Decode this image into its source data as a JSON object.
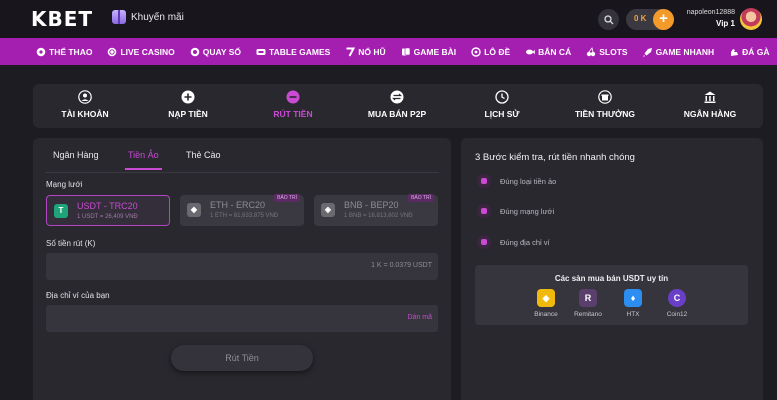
{
  "header": {
    "logo": "KBET",
    "promo_label": "Khuyến mãi",
    "balance": "0 K",
    "username": "napoleon12888",
    "vip": "Vip 1"
  },
  "nav": [
    {
      "label": "THỂ THAO",
      "icon": "soccer-ball-icon"
    },
    {
      "label": "LIVE CASINO",
      "icon": "casino-chip-icon"
    },
    {
      "label": "QUAY SỐ",
      "icon": "lottery-ball-icon"
    },
    {
      "label": "TABLE GAMES",
      "icon": "cards-icon"
    },
    {
      "label": "NỔ HŨ",
      "icon": "seven-icon"
    },
    {
      "label": "GAME BÀI",
      "icon": "playing-cards-icon"
    },
    {
      "label": "LÔ ĐỀ",
      "icon": "lotto-icon"
    },
    {
      "label": "BẮN CÁ",
      "icon": "fish-icon"
    },
    {
      "label": "SLOTS",
      "icon": "cherry-icon"
    },
    {
      "label": "GAME NHANH",
      "icon": "rocket-icon"
    },
    {
      "label": "ĐÁ GÀ",
      "icon": "rooster-icon"
    }
  ],
  "account_tabs": [
    {
      "label": "TÀI KHOẢN",
      "icon": "user-icon"
    },
    {
      "label": "NẠP TIỀN",
      "icon": "plus-circle-icon"
    },
    {
      "label": "RÚT TIỀN",
      "icon": "minus-circle-icon",
      "active": true
    },
    {
      "label": "MUA BÁN P2P",
      "icon": "swap-icon"
    },
    {
      "label": "LỊCH SỬ",
      "icon": "clock-icon"
    },
    {
      "label": "TIỀN THƯỞNG",
      "icon": "gift-icon"
    },
    {
      "label": "NGÂN HÀNG",
      "icon": "bank-icon"
    }
  ],
  "withdraw": {
    "sub_tabs": [
      "Ngân Hàng",
      "Tiền Ảo",
      "Thẻ Cào"
    ],
    "network_label": "Mạng lưới",
    "networks": [
      {
        "name": "USDT - TRC20",
        "rate": "1 USDT = 26,409 VNĐ",
        "badge": ""
      },
      {
        "name": "ETH - ERC20",
        "rate": "1 ETH = 61,633,875 VNĐ",
        "badge": "BẢO TRÌ"
      },
      {
        "name": "BNB - BEP20",
        "rate": "1 BNB = 16,813,602 VNĐ",
        "badge": "BẢO TRÌ"
      }
    ],
    "amount_label": "Số tiền rút (K)",
    "amount_hint": "1 K = 0.0379 USDT",
    "wallet_label": "Địa chỉ ví của bạn",
    "paste_label": "Dán mã",
    "submit_label": "Rút Tiền"
  },
  "guide": {
    "title": "3 Bước kiểm tra, rút tiền nhanh chóng",
    "steps": [
      "Đúng loại tiền ảo",
      "Đúng mạng lưới",
      "Đúng địa chỉ ví"
    ],
    "exchanges_title": "Các sàn mua bán USDT uy tín",
    "exchanges": [
      "Binance",
      "Remitano",
      "HTX",
      "Coin12"
    ]
  },
  "colors": {
    "accent": "#c94ad3",
    "nav_bg": "#a41fb0",
    "panel_bg": "#2a282f",
    "balance_orange": "#f39a2a"
  }
}
